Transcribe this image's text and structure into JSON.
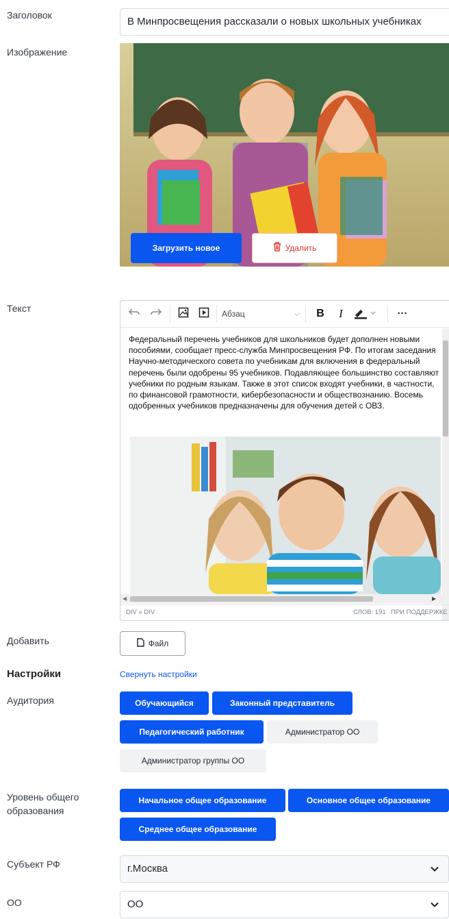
{
  "title_field": {
    "label": "Заголовок",
    "value": "В Минпросвещения рассказали о новых школьных учебниках"
  },
  "image_field": {
    "label": "Изображение",
    "upload_label": "Загрузить новое",
    "delete_label": "Удалить"
  },
  "text_field": {
    "label": "Текст",
    "toolbar": {
      "undo_icon": "undo-icon",
      "redo_icon": "redo-icon",
      "image_icon": "image-icon",
      "media_icon": "media-icon",
      "block_format": "Абзац",
      "bold": "B",
      "italic": "I",
      "more": "···"
    },
    "content": "Федеральный перечень учебников для школьников будет дополнен новыми пособиями, сообщает пресс-служба Минпросвещения РФ. По итогам заседания Научно-методического совета по учебникам для включения в федеральный перечень были одобрены 95 учебников. Подавляющее большинство составляют учебники по родным языкам. Также в этот список входят учебники, в частности, по финансовой грамотности, кибербезопасности и обществознанию. Восемь одобренных учебников предназначены для обучения детей с ОВЗ.",
    "status_path": "DIV » DIV",
    "status_words": "СЛОВ: 191",
    "status_powered": "ПРИ ПОДДЕРЖКЕ TINY"
  },
  "add_field": {
    "label": "Добавить",
    "file_label": "Файл"
  },
  "settings": {
    "label": "Настройки",
    "collapse_label": "Свернуть настройки"
  },
  "audience": {
    "label": "Аудитория",
    "options": [
      {
        "label": "Обучающийся",
        "selected": true
      },
      {
        "label": "Законный представитель",
        "selected": true
      },
      {
        "label": "Педагогический работник",
        "selected": true
      },
      {
        "label": "Администратор ОО",
        "selected": false
      },
      {
        "label": "Администратор группы ОО",
        "selected": false
      }
    ]
  },
  "education_level": {
    "label": "Уровень общего образования",
    "options": [
      {
        "label": "Начальное общее образование",
        "selected": true
      },
      {
        "label": "Основное общее образование",
        "selected": true
      },
      {
        "label": "Среднее общее образование",
        "selected": true
      }
    ]
  },
  "region": {
    "label": "Субъект РФ",
    "value": "г.Москва"
  },
  "org": {
    "label": "ОО",
    "value": "ОО"
  },
  "colors": {
    "accent": "#0a56f0",
    "delete": "#e5322d"
  }
}
